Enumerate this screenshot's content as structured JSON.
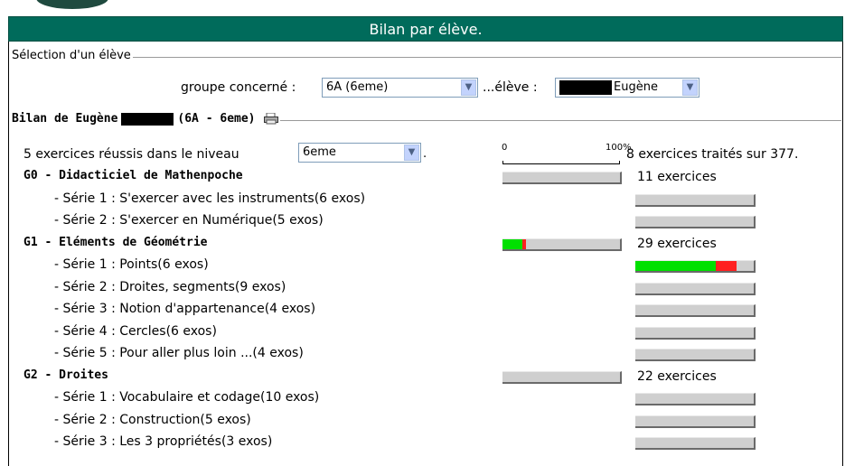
{
  "header": {
    "title": "Bilan par élève."
  },
  "selection": {
    "legend": "Sélection d'un élève",
    "group_label": "groupe concerné :",
    "group_value": "6A (6eme)",
    "student_label": "...élève :",
    "student_value": "Eugène"
  },
  "bilan": {
    "legend_prefix": "Bilan de Eugène",
    "legend_suffix": "(6A - 6eme)",
    "success_prefix": "5 exercices réussis dans le niveau",
    "level_value": "6eme",
    "success_suffix": ".",
    "scale_min": "0",
    "scale_max": "100%",
    "treated": "8 exercices traités sur 377."
  },
  "groups": [
    {
      "title": "G0 - Didacticiel de Mathenpoche",
      "count": "11 exercices",
      "success": 0,
      "fail": 0,
      "series": [
        {
          "label": "- Série 1 : S'exercer avec les instruments(6 exos)",
          "success": 0,
          "fail": 0
        },
        {
          "label": "- Série 2 : S'exercer en Numérique(5 exos)",
          "success": 0,
          "fail": 0
        }
      ]
    },
    {
      "title": "G1 - Eléments de Géométrie",
      "count": "29 exercices",
      "success": 0.17,
      "fail": 0.03,
      "series": [
        {
          "label": "- Série 1 : Points(6 exos)",
          "success": 0.67,
          "fail": 0.17
        },
        {
          "label": "- Série 2 : Droites, segments(9 exos)",
          "success": 0,
          "fail": 0
        },
        {
          "label": "- Série 3 : Notion d'appartenance(4 exos)",
          "success": 0,
          "fail": 0
        },
        {
          "label": "- Série 4 : Cercles(6 exos)",
          "success": 0,
          "fail": 0
        },
        {
          "label": "- Série 5 : Pour aller plus loin ...(4 exos)",
          "success": 0,
          "fail": 0
        }
      ]
    },
    {
      "title": "G2 - Droites",
      "count": "22 exercices",
      "success": 0,
      "fail": 0,
      "series": [
        {
          "label": "- Série 1 : Vocabulaire et codage(10 exos)",
          "success": 0,
          "fail": 0
        },
        {
          "label": "- Série 2 : Construction(5 exos)",
          "success": 0,
          "fail": 0
        },
        {
          "label": "- Série 3 : Les 3 propriétés(3 exos)",
          "success": 0,
          "fail": 0
        }
      ]
    }
  ],
  "colors": {
    "header": "#006b5b",
    "success": "#00e000",
    "fail": "#ff2020",
    "bar_bg": "#cfcfcf"
  }
}
